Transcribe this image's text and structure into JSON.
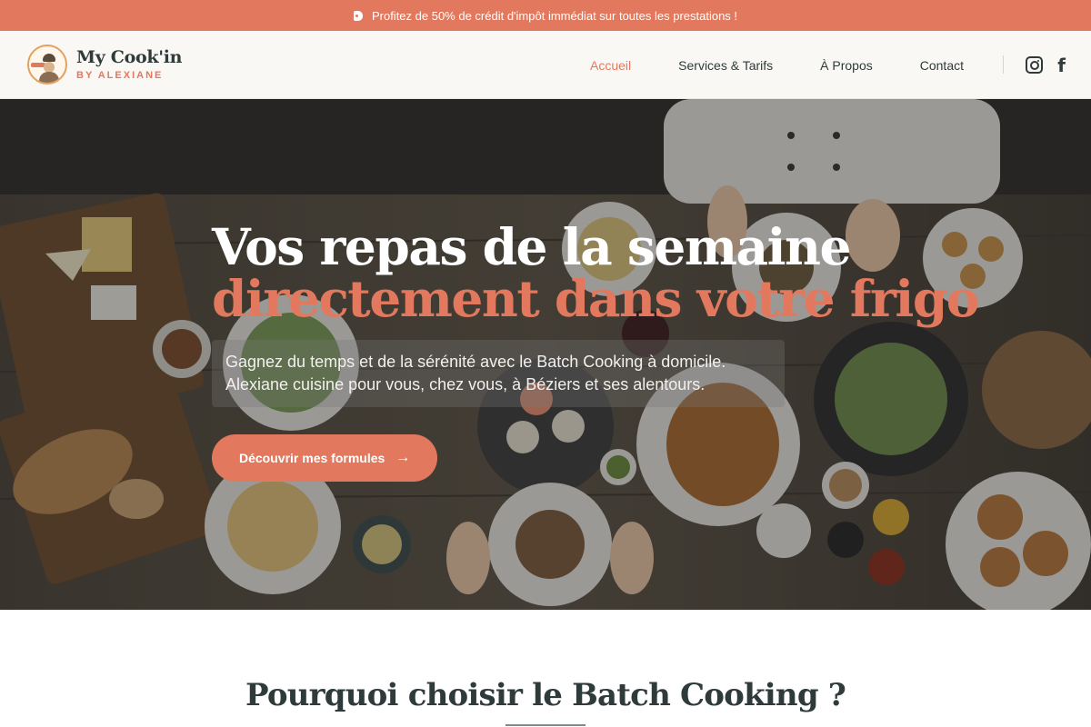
{
  "promo": {
    "text": "Profitez de 50% de crédit d'impôt immédiat sur toutes les prestations !",
    "icon": "tag-icon"
  },
  "brand": {
    "name": "My Cook'in",
    "tagline": "BY ALEXIANE"
  },
  "nav": {
    "items": [
      {
        "label": "Accueil",
        "active": true
      },
      {
        "label": "Services & Tarifs",
        "active": false
      },
      {
        "label": "À Propos",
        "active": false
      },
      {
        "label": "Contact",
        "active": false
      }
    ]
  },
  "social": {
    "instagram_icon": "instagram-icon",
    "facebook_icon": "facebook-icon"
  },
  "hero": {
    "title_line1": "Vos repas de la semaine",
    "title_line2": "directement dans votre frigo",
    "subtitle_line1": "Gagnez du temps et de la sérénité avec le Batch Cooking à domicile.",
    "subtitle_line2": "Alexiane cuisine pour vous, chez vous, à Béziers et ses alentours.",
    "cta_label": "Découvrir mes formules",
    "cta_icon": "arrow-right-icon"
  },
  "section": {
    "title": "Pourquoi choisir le Batch Cooking ?"
  },
  "colors": {
    "accent": "#e2795f",
    "text": "#2f3a3a",
    "header_bg": "#faf8f5"
  }
}
